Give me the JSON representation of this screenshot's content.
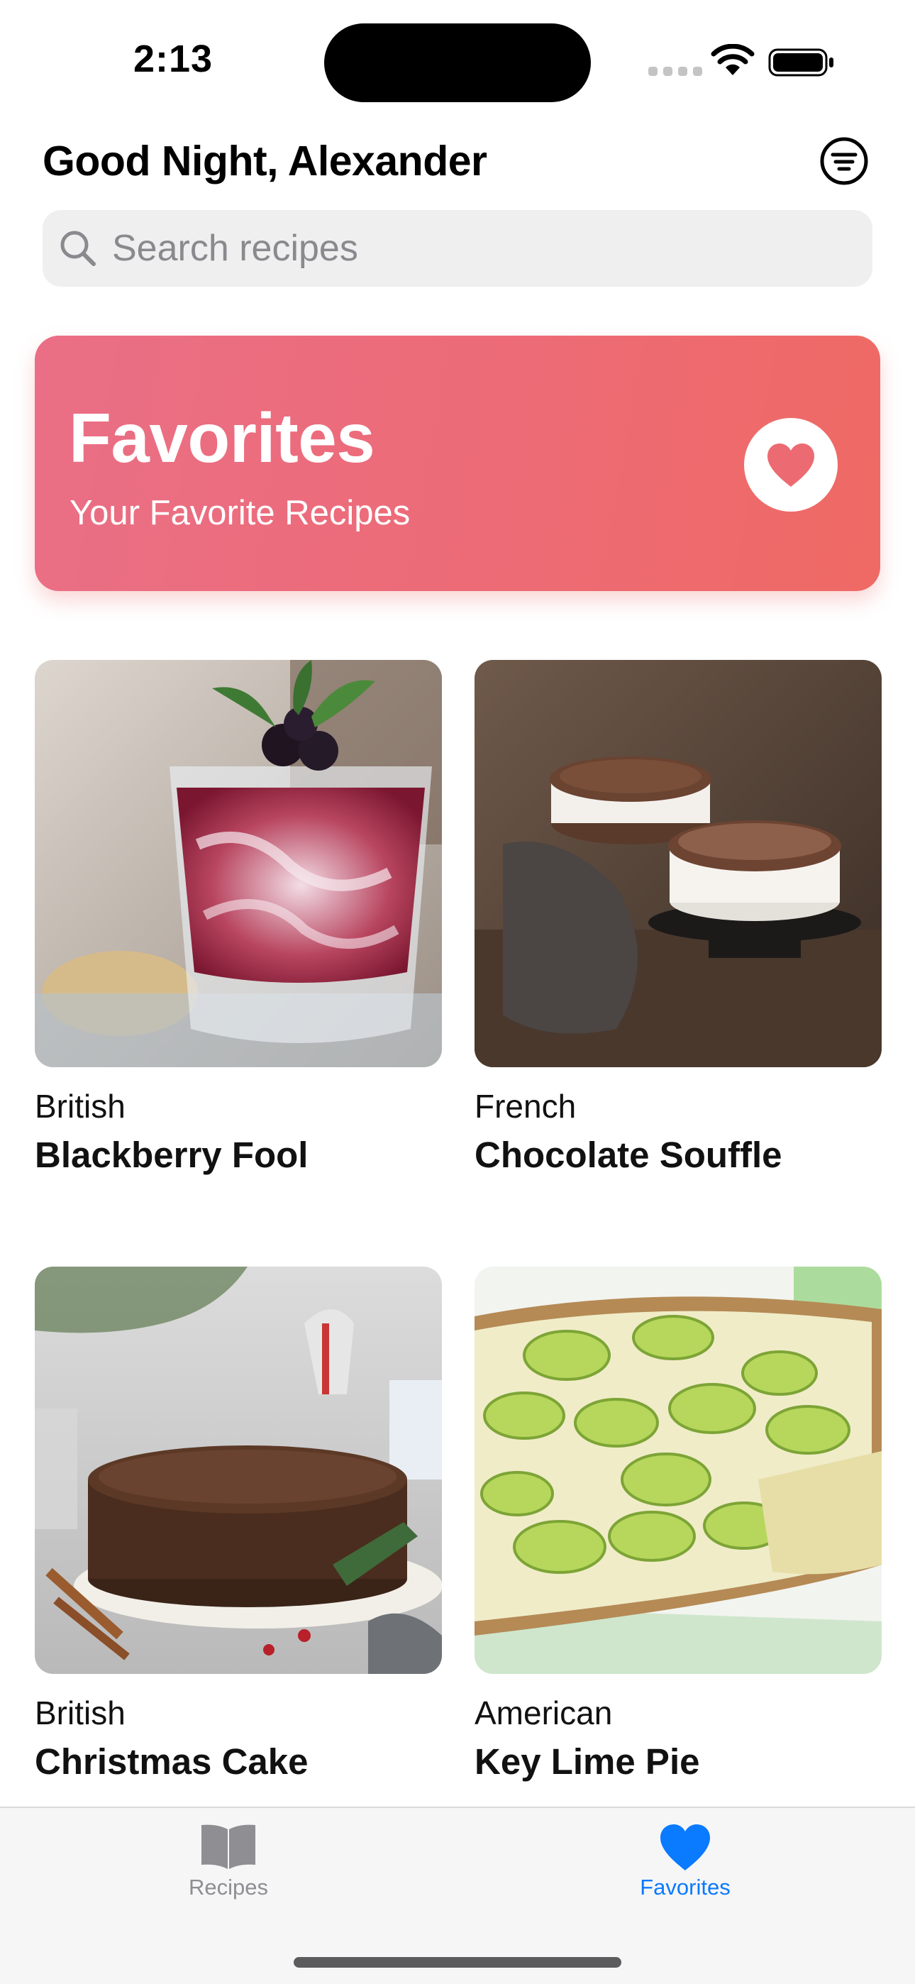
{
  "status_bar": {
    "time": "2:13"
  },
  "header": {
    "greeting": "Good Night, Alexander"
  },
  "search": {
    "placeholder": "Search recipes"
  },
  "banner": {
    "title": "Favorites",
    "subtitle": "Your Favorite Recipes"
  },
  "recipes": [
    {
      "cuisine": "British",
      "name": "Blackberry Fool"
    },
    {
      "cuisine": "French",
      "name": "Chocolate Souffle"
    },
    {
      "cuisine": "British",
      "name": "Christmas Cake"
    },
    {
      "cuisine": "American",
      "name": "Key Lime Pie"
    }
  ],
  "tabs": [
    {
      "label": "Recipes",
      "icon": "book-icon",
      "selected": false
    },
    {
      "label": "Favorites",
      "icon": "heart-icon",
      "selected": true
    }
  ],
  "colors": {
    "accent": "#0a7aff",
    "banner_start": "#ea6f86",
    "banner_end": "#ef6a64",
    "inactive_tab": "#8e8e93"
  }
}
